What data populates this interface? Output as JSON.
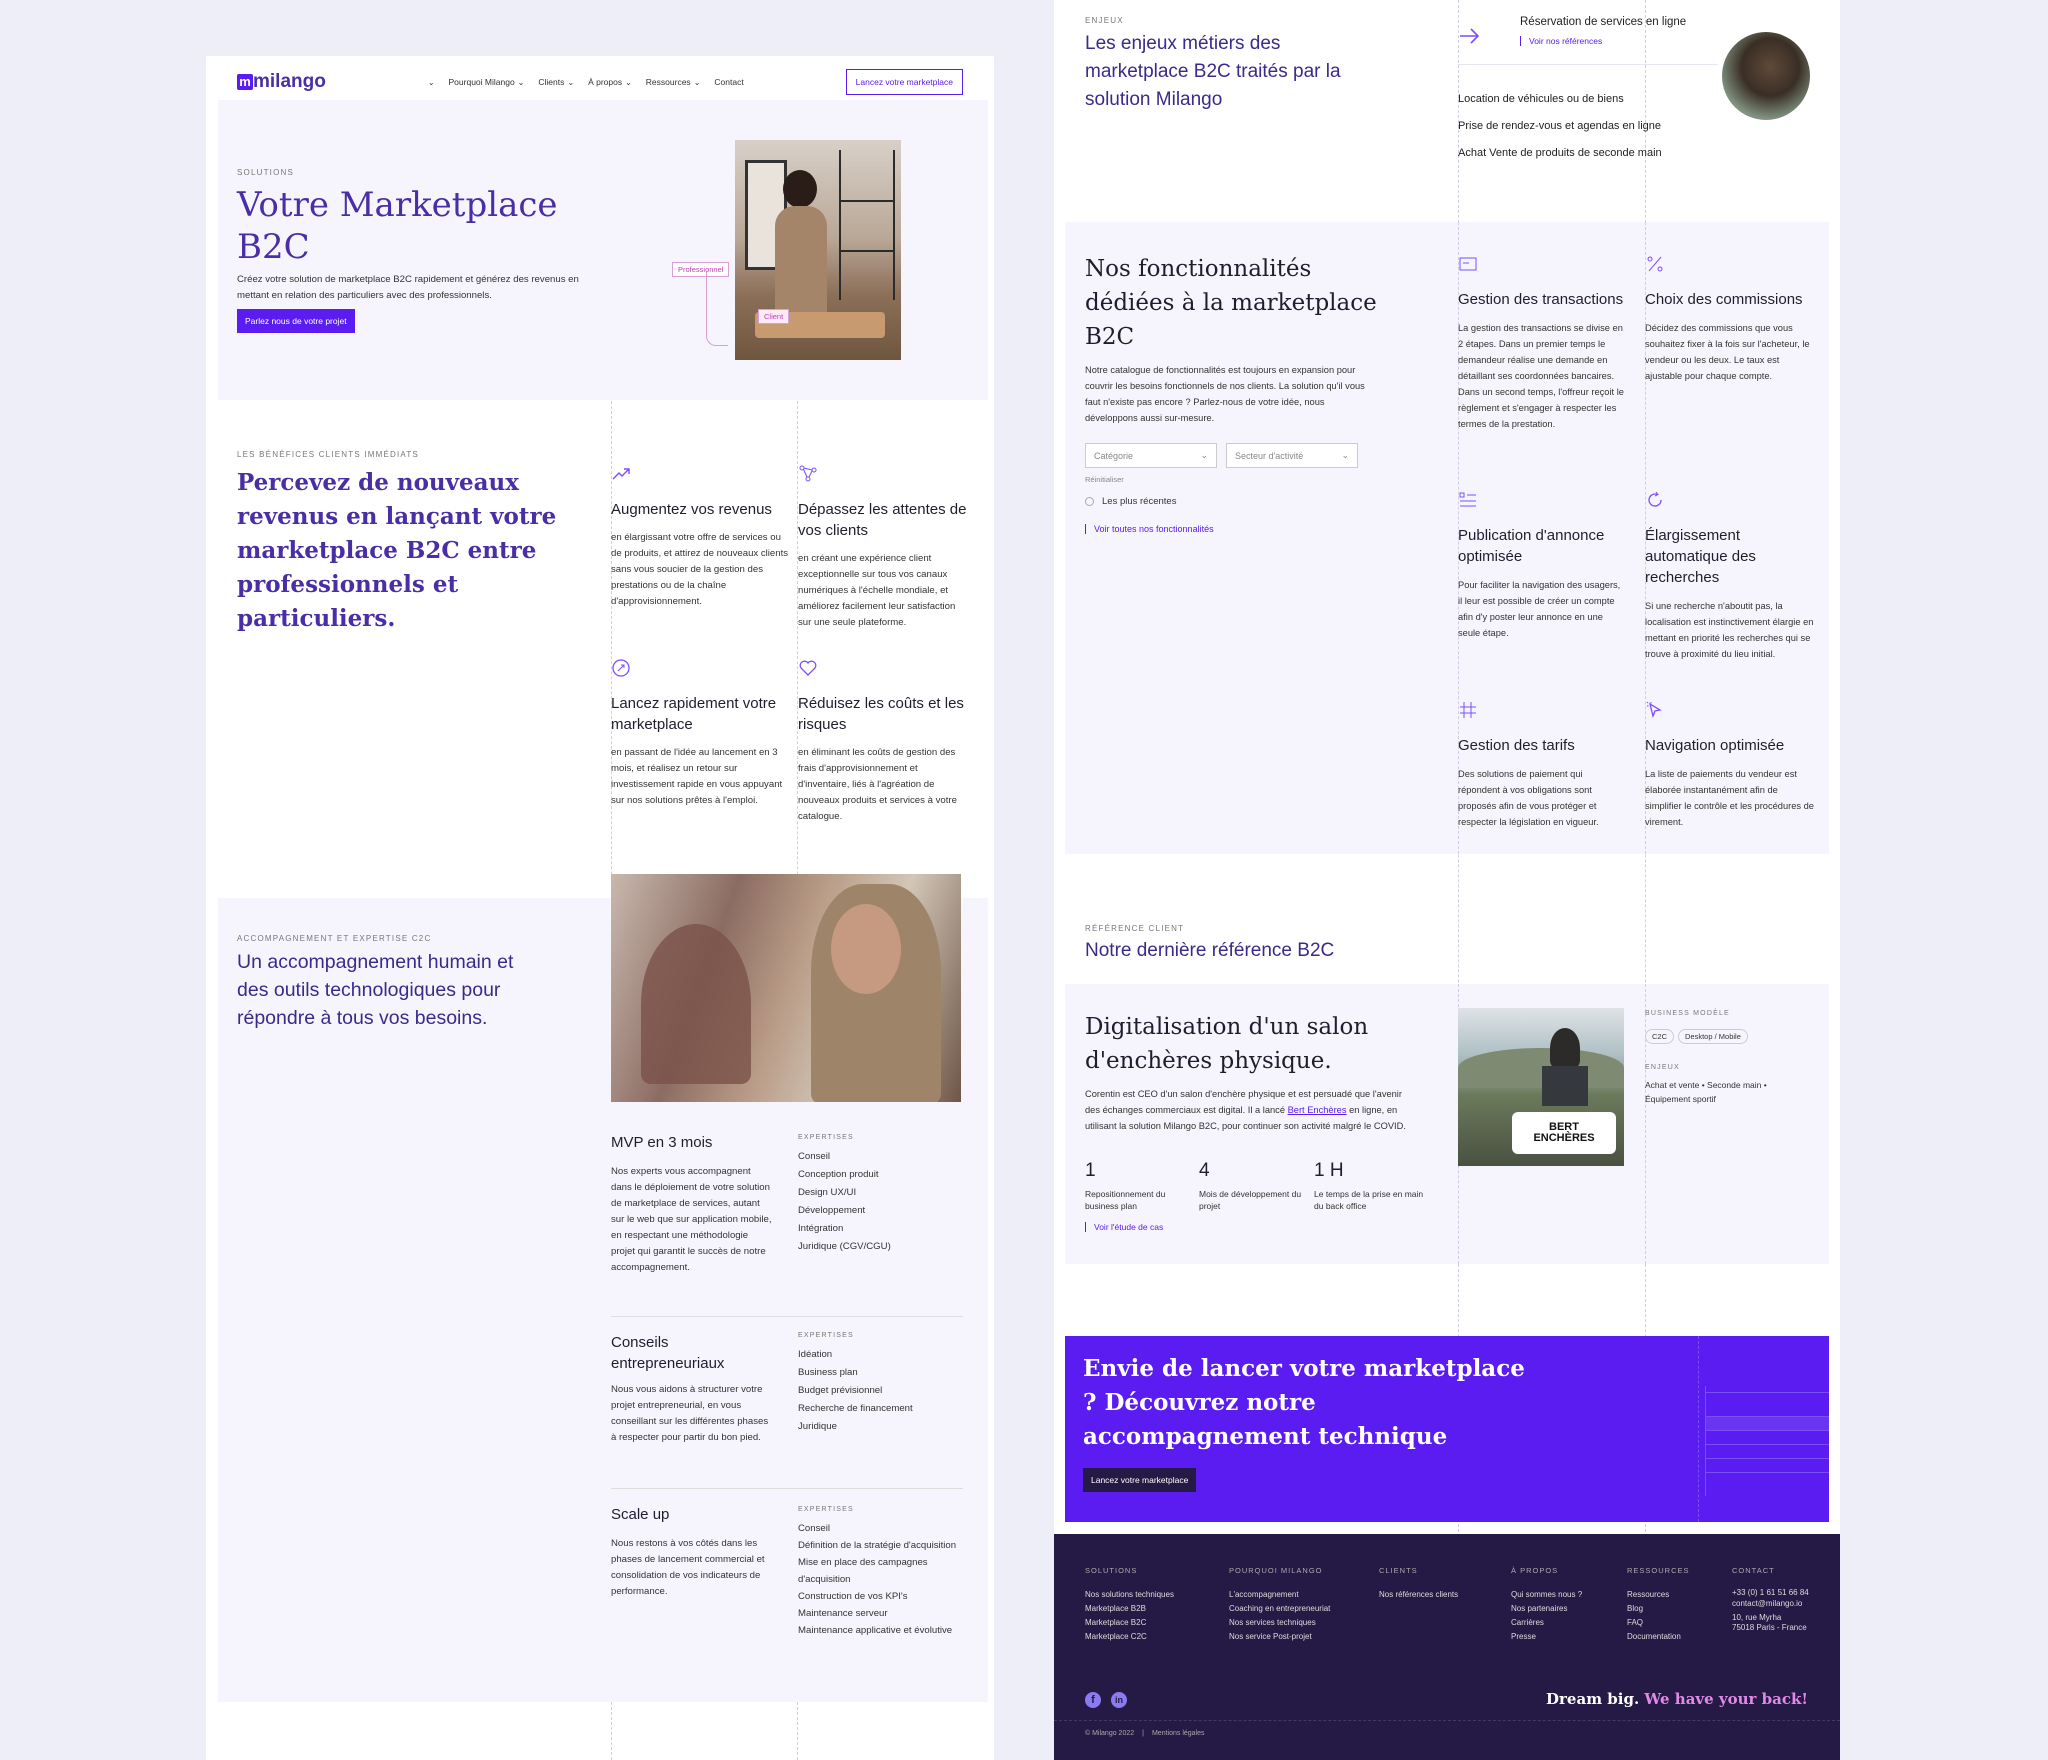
{
  "nav": {
    "logo": "milango",
    "logo_mark": "m",
    "items": [
      "Pourquoi Milango",
      "Clients",
      "À propos",
      "Ressources",
      "Contact"
    ],
    "cta": "Lancez votre marketplace"
  },
  "hero": {
    "eyebrow": "SOLUTIONS",
    "title": "Votre Marketplace B2C",
    "text": "Créez votre solution de marketplace B2C rapidement et générez des revenus en mettant en relation des particuliers avec des professionnels.",
    "cta": "Parlez nous de votre projet",
    "tag_pro": "Professionnel",
    "tag_client": "Client"
  },
  "benefits": {
    "eyebrow": "LES BÉNÉFICES CLIENTS IMMÉDIATS",
    "title": "Percevez de nouveaux revenus en lançant votre marketplace B2C entre professionnels et particuliers.",
    "items": [
      {
        "icon": "trending-up-icon",
        "title": "Augmentez vos revenus",
        "text": "en élargissant votre offre de services ou de produits, et attirez de nouveaux clients sans vous soucier de la gestion des prestations ou de la chaîne d'approvisionnement."
      },
      {
        "icon": "network-icon",
        "title": "Dépassez les attentes de vos clients",
        "text": "en créant une expérience client exceptionnelle sur tous vos canaux numériques à l'échelle mondiale, et améliorez facilement leur satisfaction sur une seule plateforme."
      },
      {
        "icon": "rocket-icon",
        "title": "Lancez rapidement votre marketplace",
        "text": "en passant de l'idée au lancement en 3 mois, et réalisez un retour sur investissement rapide en vous appuyant sur nos solutions prêtes à l'emploi."
      },
      {
        "icon": "heart-icon",
        "title": "Réduisez les coûts et les risques",
        "text": "en éliminant les coûts de gestion des frais d'approvisionnement et d'inventaire, liés à l'agréation de nouveaux produits et services à votre catalogue."
      }
    ]
  },
  "support": {
    "eyebrow": "ACCOMPAGNEMENT ET EXPERTISE C2C",
    "title": "Un accompagnement humain et des outils technologiques pour répondre à tous vos besoins.",
    "expertise_label": "EXPERTISES",
    "blocks": [
      {
        "title": "MVP en 3 mois",
        "text": "Nos experts vous accompagnent dans le déploiement de votre solution de marketplace de services, autant sur le web que sur application mobile, en respectant une méthodologie projet qui garantit le succès de notre accompagnement.",
        "list": [
          "Conseil",
          "Conception produit",
          "Design UX/UI",
          "Développement",
          "Intégration",
          "Juridique (CGV/CGU)"
        ]
      },
      {
        "title": "Conseils entrepreneuriaux",
        "text": "Nous vous aidons à structurer votre projet entrepreneurial, en vous conseillant sur les différentes phases à respecter pour partir du bon pied.",
        "list": [
          "Idéation",
          "Business plan",
          "Budget prévisionnel",
          "Recherche de financement",
          "Juridique"
        ]
      },
      {
        "title": "Scale up",
        "text": "Nous restons à vos côtés dans les phases de lancement commercial et consolidation de vos indicateurs de performance.",
        "list": [
          "Conseil",
          "Définition de la stratégie d'acquisition",
          "Mise en place des campagnes d'acquisition",
          "Construction de vos KPI's",
          "Maintenance serveur",
          "Maintenance applicative et évolutive"
        ]
      }
    ]
  },
  "enjeux": {
    "eyebrow": "ENJEUX",
    "title": "Les enjeux métiers des marketplace B2C traités par la solution Milango",
    "highlight": "Réservation de services en ligne",
    "link": "Voir nos références",
    "items": [
      "Location de véhicules ou de biens",
      "Prise de rendez-vous et agendas en ligne",
      "Achat Vente de produits de seconde main"
    ]
  },
  "features": {
    "title": "Nos fonctionnalités dédiées à la marketplace B2C",
    "text": "Notre catalogue de fonctionnalités est toujours en expansion pour couvrir les besoins fonctionnels de nos clients. La solution qu'il vous faut n'existe pas encore ? Parlez-nous de votre idée, nous développons aussi sur-mesure.",
    "filter1": "Catégorie",
    "filter2": "Secteur d'activité",
    "reset": "Réinitialiser",
    "radio": "Les plus récentes",
    "link": "Voir toutes nos fonctionnalités",
    "items": [
      {
        "icon": "card-icon",
        "title": "Gestion des transactions",
        "text": "La gestion des transactions se divise en 2 étapes. Dans un premier temps le demandeur réalise une demande en détaillant ses coordonnées bancaires. Dans un second temps, l'offreur reçoit le règlement et s'engager à respecter les termes de la prestation."
      },
      {
        "icon": "percent-icon",
        "title": "Choix des commissions",
        "text": "Décidez des commissions que vous souhaitez fixer à la fois sur l'acheteur, le vendeur ou les deux. Le taux est ajustable pour chaque compte."
      },
      {
        "icon": "list-icon",
        "title": "Publication d'annonce optimisée",
        "text": "Pour faciliter la navigation des usagers, il leur est possible de créer un compte afin d'y poster leur annonce en une seule étape."
      },
      {
        "icon": "refresh-icon",
        "title": "Élargissement automatique des recherches",
        "text": "Si une recherche n'aboutit pas, la localisation est instinctivement élargie en mettant en priorité les recherches qui se trouve à proximité du lieu initial."
      },
      {
        "icon": "grid-icon",
        "title": "Gestion des tarifs",
        "text": "Des solutions de paiement qui répondent à vos obligations sont proposés afin de vous protéger et respecter la législation en vigueur."
      },
      {
        "icon": "cursor-icon",
        "title": "Navigation optimisée",
        "text": "La liste de paiements du vendeur est élaborée instantanément afin de simplifier le contrôle et les procédures de virement."
      }
    ]
  },
  "reference": {
    "eyebrow": "RÉFÉRENCE CLIENT",
    "title": "Notre dernière référence B2C",
    "case_title": "Digitalisation d'un salon d'enchères physique.",
    "case_text_before": "Corentin est CEO d'un salon d'enchère physique et est persuadé que l'avenir des échanges commerciaux est digital. Il a lancé",
    "case_link": "Bert Enchères",
    "case_text_after": "en ligne, en utilisant la solution Milango B2C, pour continuer son activité malgré le COVID.",
    "logo_text": "BERT ENCHÈRES",
    "stats": [
      {
        "num": "1",
        "label": "Repositionnement du business plan"
      },
      {
        "num": "4",
        "label": "Mois de développement du projet"
      },
      {
        "num": "1 H",
        "label": "Le temps de la prise en main du back office"
      }
    ],
    "case_link_cta": "Voir l'étude de cas",
    "bm_label": "BUSINESS MODÈLE",
    "bm_chips": [
      "C2C",
      "Desktop / Mobile"
    ],
    "enjeux_label": "ENJEUX",
    "enjeux_text": "Achat et vente • Seconde main • Équipement sportif"
  },
  "cta_banner": {
    "title": "Envie de lancer votre marketplace ? Découvrez notre accompagnement technique",
    "button": "Lancez votre marketplace"
  },
  "footer": {
    "cols": [
      {
        "h": "SOLUTIONS",
        "items": [
          "Nos solutions techniques",
          "Marketplace B2B",
          "Marketplace B2C",
          "Marketplace C2C"
        ]
      },
      {
        "h": "POURQUOI MILANGO",
        "items": [
          "L'accompagnement",
          "Coaching en entrepreneuriat",
          "Nos services techniques",
          "Nos service Post-projet"
        ]
      },
      {
        "h": "CLIENTS",
        "items": [
          "Nos références clients"
        ]
      },
      {
        "h": "À PROPOS",
        "items": [
          "Qui sommes nous ?",
          "Nos partenaires",
          "Carrières",
          "Presse"
        ]
      },
      {
        "h": "RESSOURCES",
        "items": [
          "Ressources",
          "Blog",
          "FAQ",
          "Documentation"
        ]
      },
      {
        "h": "CONTACT",
        "items": [
          "+33 (0) 1 61 51 66 84",
          "contact@milango.io",
          "10, rue Myrha",
          "75018 Paris - France"
        ]
      }
    ],
    "slogan_a": "Dream big.",
    "slogan_b": "We have your back!",
    "copyright": "© Milango 2022",
    "legal": "Mentions légales"
  },
  "colors": {
    "accent": "#5a1cf0",
    "title": "#4a2ea5",
    "footer_bg": "#241a45",
    "lavender": "#f6f5fd"
  }
}
